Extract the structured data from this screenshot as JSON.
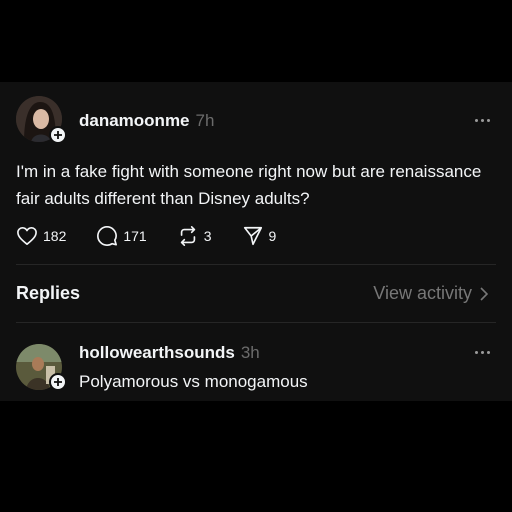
{
  "post": {
    "username": "danamoonme",
    "time": "7h",
    "text": "I'm in a fake fight with someone right now but are renaissance fair adults different than Disney adults?",
    "likes": "182",
    "comments": "171",
    "reposts": "3",
    "shares": "9"
  },
  "replies_section": {
    "label": "Replies",
    "view_activity": "View activity"
  },
  "reply": {
    "username": "hollowearthsounds",
    "time": "3h",
    "text": "Polyamorous vs monogamous"
  },
  "icons": {
    "like": "heart-icon",
    "comment": "comment-bubble-icon",
    "repost": "repost-icon",
    "share": "send-icon",
    "more": "more-dots-icon",
    "follow": "plus-icon",
    "chevron": "chevron-right-icon"
  }
}
